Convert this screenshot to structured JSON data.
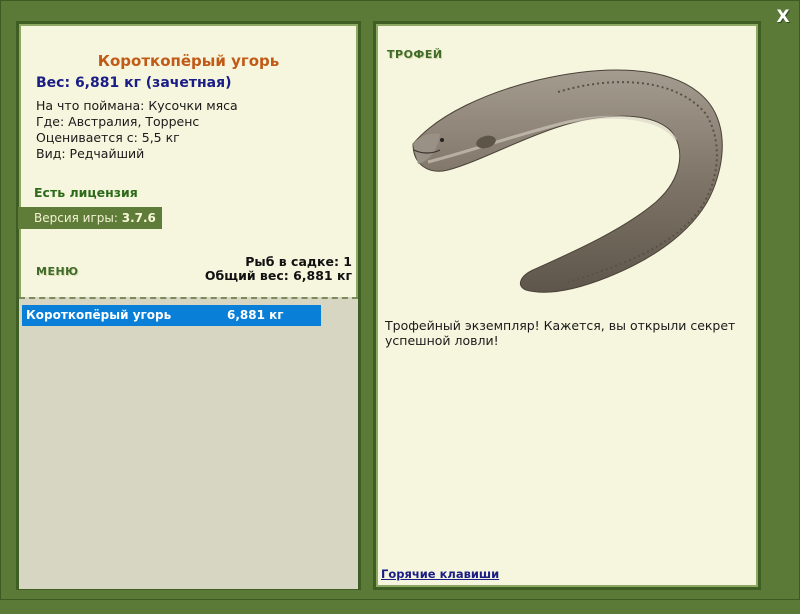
{
  "close_label": "X",
  "fish": {
    "title": "Короткопёрый угорь",
    "weight": "Вес: 6,881 кг (зачетная)",
    "bait": "На что поймана: Кусочки мяса",
    "location": "Где: Австралия, Торренс",
    "rated_from": "Оценивается с: 5,5 кг",
    "rarity": "Вид: Редчайший"
  },
  "license": "Есть лицензия",
  "version": {
    "label": "Версия игры:",
    "value": "3.7.6"
  },
  "menu_label": "МЕНЮ",
  "keepnet": {
    "count": "Рыб в садке: 1",
    "total": "Общий вес: 6,881 кг"
  },
  "catch_list": [
    {
      "name": "Короткопёрый угорь",
      "weight": "6,881 кг"
    }
  ],
  "trophy": {
    "label": "ТРОФЕЙ",
    "text": "Трофейный экземпляр! Кажется, вы открыли секрет успешной ловли!",
    "image_icon": "eel-image"
  },
  "hotkeys": "Горячие клавиши",
  "colors": {
    "background": "#5b7a38",
    "panel": "#f6f6de",
    "title": "#c05a16",
    "weight": "#1a1d86",
    "selection": "#0a7fd8"
  }
}
